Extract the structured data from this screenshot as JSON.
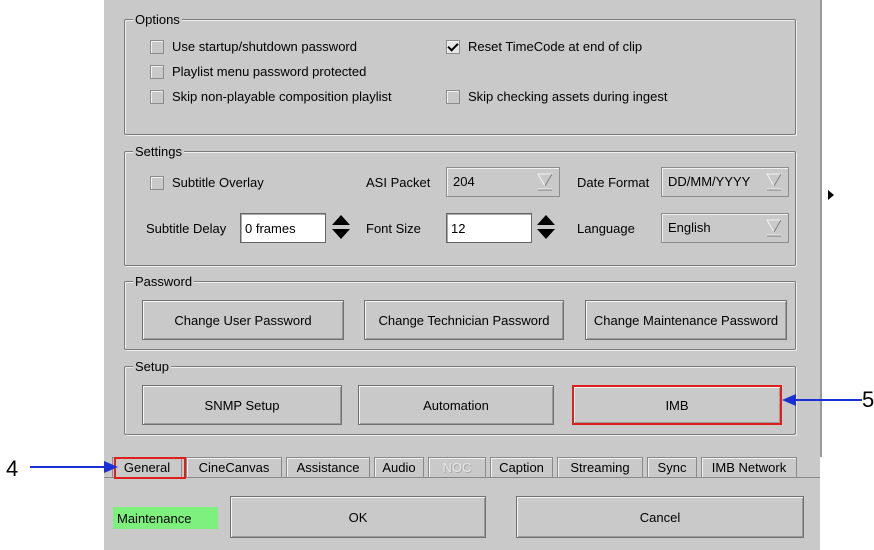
{
  "options": {
    "title": "Options",
    "items": [
      {
        "label": "Use startup/shutdown password",
        "checked": false
      },
      {
        "label": "Reset TimeCode at end of clip",
        "checked": true
      },
      {
        "label": "Playlist menu password protected",
        "checked": false
      },
      {
        "label": "Skip non-playable composition playlist",
        "checked": false
      },
      {
        "label": "Skip checking assets during ingest",
        "checked": false
      }
    ]
  },
  "settings": {
    "title": "Settings",
    "subtitle_overlay": {
      "label": "Subtitle Overlay",
      "checked": false
    },
    "asi_packet": {
      "label": "ASI Packet",
      "value": "204"
    },
    "date_format": {
      "label": "Date Format",
      "value": "DD/MM/YYYY"
    },
    "subtitle_delay": {
      "label": "Subtitle Delay",
      "value": "0  frames"
    },
    "font_size": {
      "label": "Font Size",
      "value": "12"
    },
    "language": {
      "label": "Language",
      "value": "English"
    }
  },
  "password": {
    "title": "Password",
    "buttons": [
      "Change User Password",
      "Change Technician Password",
      "Change Maintenance Password"
    ]
  },
  "setup": {
    "title": "Setup",
    "buttons": [
      "SNMP Setup",
      "Automation",
      "IMB"
    ]
  },
  "tabs": [
    "General",
    "CineCanvas",
    "Assistance",
    "Audio",
    "NOC",
    "Caption",
    "Streaming",
    "Sync",
    "IMB Network"
  ],
  "active_tab": "General",
  "disabled_tabs": [
    "NOC"
  ],
  "status": "Maintenance",
  "status_color": "#7df07d",
  "ok_label": "OK",
  "cancel_label": "Cancel",
  "callouts": {
    "tab": "4",
    "imb": "5"
  },
  "highlight_color": "#e01e1e",
  "arrow_color": "#1a2fd6"
}
